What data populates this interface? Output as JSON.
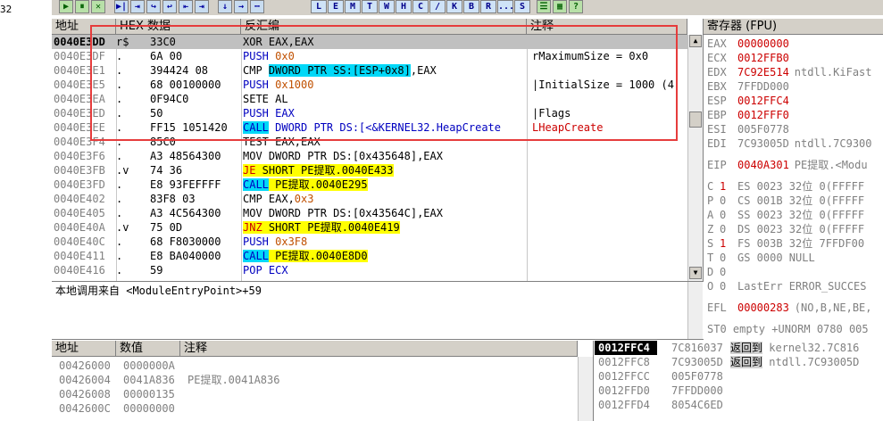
{
  "left_strip_text": "32",
  "toolbar": {
    "buttons": [
      "▶",
      "⏸",
      "✕",
      "▶|",
      "⇥",
      "↪",
      "↩",
      "⇤",
      "⇥",
      "↓",
      "→",
      "⋯"
    ],
    "letter_buttons": [
      "L",
      "E",
      "M",
      "T",
      "W",
      "H",
      "C",
      "/",
      "K",
      "B",
      "R",
      "...",
      "S"
    ],
    "extra": [
      "☰",
      "▦",
      "?"
    ]
  },
  "cpu": {
    "headers": {
      "address": "地址",
      "hex": "HEX 数据",
      "disasm": "反汇编",
      "comment": "注释"
    },
    "rows": [
      {
        "addr": "0040E3DD",
        "mark": "r$",
        "hex": "33C0",
        "dis": [
          {
            "t": "XOR EAX,EAX",
            "c": ""
          }
        ],
        "cmt": []
      },
      {
        "addr": "0040E3DF",
        "mark": ".",
        "hex": "6A 00",
        "dis": [
          {
            "t": "PUSH ",
            "c": "kw-blue"
          },
          {
            "t": "0x0",
            "c": "num-orange"
          }
        ],
        "cmt": [
          {
            "t": "rMaximumSize = 0x0",
            "c": ""
          }
        ]
      },
      {
        "addr": "0040E3E1",
        "mark": ".",
        "hex": "394424 08",
        "dis": [
          {
            "t": "CMP ",
            "c": ""
          },
          {
            "t": "DWORD PTR SS:[ESP+0x8]",
            "c": "hl-blue"
          },
          {
            "t": ",EAX",
            "c": ""
          }
        ],
        "cmt": []
      },
      {
        "addr": "0040E3E5",
        "mark": ".",
        "hex": "68 00100000",
        "dis": [
          {
            "t": "PUSH ",
            "c": "kw-blue"
          },
          {
            "t": "0x1000",
            "c": "num-orange"
          }
        ],
        "cmt": [
          {
            "t": "|InitialSize = 1000 (4",
            "c": ""
          }
        ]
      },
      {
        "addr": "0040E3EA",
        "mark": ".",
        "hex": "0F94C0",
        "dis": [
          {
            "t": "SETE AL",
            "c": ""
          }
        ],
        "cmt": []
      },
      {
        "addr": "0040E3ED",
        "mark": ".",
        "hex": "50",
        "dis": [
          {
            "t": "PUSH ",
            "c": "kw-blue"
          },
          {
            "t": "EAX",
            "c": "kw-blue"
          }
        ],
        "cmt": [
          {
            "t": "|Flags",
            "c": ""
          }
        ]
      },
      {
        "addr": "0040E3EE",
        "mark": ".",
        "hex": "FF15 1051420",
        "dis": [
          {
            "t": "CALL",
            "c": "hl-call"
          },
          {
            "t": " DWORD PTR DS:[<&KERNEL32.HeapCreate",
            "c": "kw-blue"
          }
        ],
        "cmt": [
          {
            "t": "LHeapCreate",
            "c": "red"
          }
        ]
      },
      {
        "addr": "0040E3F4",
        "mark": ".",
        "hex": "85C0",
        "dis": [
          {
            "t": "TEST EAX,EAX",
            "c": ""
          }
        ],
        "cmt": []
      },
      {
        "addr": "0040E3F6",
        "mark": ".",
        "hex": "A3 48564300",
        "dis": [
          {
            "t": "MOV DWORD PTR DS:[0x435648],EAX",
            "c": ""
          }
        ],
        "cmt": []
      },
      {
        "addr": "0040E3FB",
        "mark": ".v",
        "hex": "74 36",
        "dis": [
          {
            "t": "JE",
            "c": "hl-jmp"
          },
          {
            "t": " SHORT PE提取.0040E433",
            "c": "hl-yellow"
          }
        ],
        "cmt": []
      },
      {
        "addr": "0040E3FD",
        "mark": ".",
        "hex": "E8 93FEFFFF",
        "dis": [
          {
            "t": "CALL",
            "c": "hl-call"
          },
          {
            "t": " PE提取.0040E295",
            "c": "hl-yellow"
          }
        ],
        "cmt": []
      },
      {
        "addr": "0040E402",
        "mark": ".",
        "hex": "83F8 03",
        "dis": [
          {
            "t": "CMP EAX,",
            "c": ""
          },
          {
            "t": "0x3",
            "c": "num-orange"
          }
        ],
        "cmt": []
      },
      {
        "addr": "0040E405",
        "mark": ".",
        "hex": "A3 4C564300",
        "dis": [
          {
            "t": "MOV DWORD PTR DS:[0x43564C],EAX",
            "c": ""
          }
        ],
        "cmt": []
      },
      {
        "addr": "0040E40A",
        "mark": ".v",
        "hex": "75 0D",
        "dis": [
          {
            "t": "JNZ",
            "c": "hl-jmp"
          },
          {
            "t": " SHORT PE提取.0040E419",
            "c": "hl-yellow"
          }
        ],
        "cmt": []
      },
      {
        "addr": "0040E40C",
        "mark": ".",
        "hex": "68 F8030000",
        "dis": [
          {
            "t": "PUSH ",
            "c": "kw-blue"
          },
          {
            "t": "0x3F8",
            "c": "num-orange"
          }
        ],
        "cmt": []
      },
      {
        "addr": "0040E411",
        "mark": ".",
        "hex": "E8 BA040000",
        "dis": [
          {
            "t": "CALL",
            "c": "hl-call"
          },
          {
            "t": " PE提取.0040E8D0",
            "c": "hl-yellow"
          }
        ],
        "cmt": []
      },
      {
        "addr": "0040E416",
        "mark": ".",
        "hex": "59",
        "dis": [
          {
            "t": "POP ",
            "c": "kw-blue"
          },
          {
            "t": "ECX",
            "c": "kw-blue"
          }
        ],
        "cmt": []
      }
    ]
  },
  "info": {
    "text": "本地调用来自 <ModuleEntryPoint>+59"
  },
  "registers": {
    "header": "寄存器 (FPU)",
    "gp": [
      {
        "name": "EAX",
        "value": "00000000",
        "red": true,
        "desc": ""
      },
      {
        "name": "ECX",
        "value": "0012FFB0",
        "red": true,
        "desc": ""
      },
      {
        "name": "EDX",
        "value": "7C92E514",
        "red": true,
        "desc": "ntdll.KiFast"
      },
      {
        "name": "EBX",
        "value": "7FFDD000",
        "red": false,
        "desc": ""
      },
      {
        "name": "ESP",
        "value": "0012FFC4",
        "red": true,
        "desc": ""
      },
      {
        "name": "EBP",
        "value": "0012FFF0",
        "red": true,
        "desc": ""
      },
      {
        "name": "ESI",
        "value": "005F0778",
        "red": false,
        "desc": ""
      },
      {
        "name": "EDI",
        "value": "7C93005D",
        "red": false,
        "desc": "ntdll.7C9300"
      }
    ],
    "eip": {
      "name": "EIP",
      "value": "0040A301",
      "desc": "PE提取.<Modu"
    },
    "flags": [
      {
        "f": "C",
        "v": "1",
        "red": true,
        "seg": "ES 0023 32位 0(FFFFF"
      },
      {
        "f": "P",
        "v": "0",
        "red": false,
        "seg": "CS 001B 32位 0(FFFFF"
      },
      {
        "f": "A",
        "v": "0",
        "red": false,
        "seg": "SS 0023 32位 0(FFFFF"
      },
      {
        "f": "Z",
        "v": "0",
        "red": false,
        "seg": "DS 0023 32位 0(FFFFF"
      },
      {
        "f": "S",
        "v": "1",
        "red": true,
        "seg": "FS 003B 32位 7FFDF00"
      },
      {
        "f": "T",
        "v": "0",
        "red": false,
        "seg": "GS 0000 NULL"
      },
      {
        "f": "D",
        "v": "0",
        "red": false,
        "seg": ""
      },
      {
        "f": "O",
        "v": "0",
        "red": false,
        "seg": "LastErr ERROR_SUCCES"
      }
    ],
    "efl": {
      "name": "EFL",
      "value": "00000283",
      "desc": "(NO,B,NE,BE,"
    },
    "st0": "ST0 empty +UNORM 0780 005"
  },
  "dump": {
    "headers": {
      "address": "地址",
      "value": "数值",
      "comment": "注释"
    },
    "rows": [
      {
        "addr": "00426000",
        "val": "0000000A",
        "cmt": ""
      },
      {
        "addr": "00426004",
        "val": "0041A836",
        "cmt": "PE提取.0041A836"
      },
      {
        "addr": "00426008",
        "val": "00000135",
        "cmt": ""
      },
      {
        "addr": "0042600C",
        "val": "00000000",
        "cmt": ""
      }
    ]
  },
  "stack": {
    "rows": [
      {
        "addr": "0012FFC4",
        "val": "7C816037",
        "pre": "返回到",
        "cmt": " kernel32.7C816",
        "sel": true
      },
      {
        "addr": "0012FFC8",
        "val": "7C93005D",
        "pre": "返回到",
        "cmt": " ntdll.7C93005D",
        "sel": false
      },
      {
        "addr": "0012FFCC",
        "val": "005F0778",
        "pre": "",
        "cmt": "",
        "sel": false
      },
      {
        "addr": "0012FFD0",
        "val": "7FFDD000",
        "pre": "",
        "cmt": "",
        "sel": false
      },
      {
        "addr": "0012FFD4",
        "val": "8054C6ED",
        "pre": "",
        "cmt": "",
        "sel": false
      }
    ]
  }
}
